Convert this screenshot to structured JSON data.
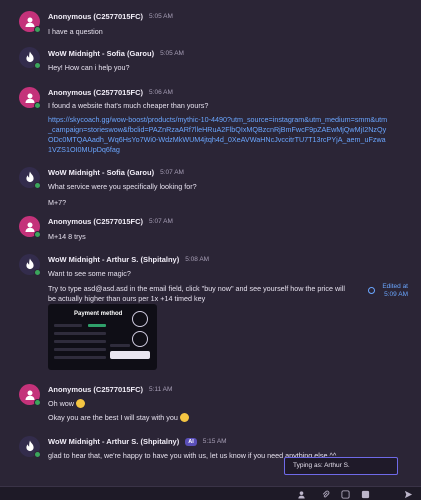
{
  "messages": [
    {
      "author": "Anonymous (C2577015FC)",
      "time": "5:05 AM",
      "avatar": "pink",
      "lines": [
        "I have a question"
      ]
    },
    {
      "author": "WoW Midnight - Sofia (Garou)",
      "time": "5:05 AM",
      "avatar": "purple",
      "lines": [
        "Hey! How can i help you?"
      ]
    },
    {
      "author": "Anonymous (C2577015FC)",
      "time": "5:06 AM",
      "avatar": "pink",
      "lines": [
        "I found a website that's much cheaper than yours?"
      ],
      "link": "https://skycoach.gg/wow-boost/products/mythic-10-4490?utm_source=instagram&utm_medium=smm&utm_campaign=storieswow&fbclid=PAZnRzaARf7lleHRuA2FlbQIxMQBzcnRjBmFwcF9pZAEwMjQwMjI2NzQyODc0MTQAAadh_Wq6HsYo7Wi0-WdzMkWUM4jtqh4d_0XeAVWaHNcJvccitrTU7T13rcPYjA_aem_uFzwa1VZS1OI0MUpDq6fag"
    },
    {
      "author": "WoW Midnight - Sofia (Garou)",
      "time": "5:07 AM",
      "avatar": "purple",
      "lines": [
        "What service were you specifically looking for?",
        "M+7?"
      ]
    },
    {
      "author": "Anonymous (C2577015FC)",
      "time": "5:07 AM",
      "avatar": "pink",
      "lines": [
        "M+14 8 trys"
      ]
    },
    {
      "author": "WoW Midnight - Arthur S. (Shpitalny)",
      "time": "5:08 AM",
      "avatar": "purple",
      "lines": [
        "Want to see some magic?",
        "Try to type asd@asd.asd in the email field, click \"buy now\" and see yourself how the price will be actually higher than ours per 1x +14 timed key"
      ],
      "edited": [
        "Edited at",
        "5:09 AM"
      ],
      "image": {
        "title": "Payment method",
        "label": "payment-method-screenshot"
      }
    },
    {
      "author": "Anonymous (C2577015FC)",
      "time": "5:11 AM",
      "avatar": "pink",
      "lines": [
        "Oh wow",
        "Okay you are the best I will stay with you"
      ]
    },
    {
      "author": "WoW Midnight - Arthur S. (Shpitalny)",
      "time": "5:15 AM",
      "avatar": "purple",
      "badge": "AI",
      "lines": [
        "glad to hear that, we're happy to have you with us, let us know if you need anything else ^^"
      ]
    }
  ],
  "typing_indicator": "Typing as: Arthur S.",
  "colors": {
    "accent": "#6f6ae8",
    "link": "#6aa6ff",
    "online": "#3ba55c",
    "anon_avatar": "#c4327a",
    "agent_avatar": "#332c4c"
  },
  "icons": [
    "fire-logo-icon",
    "user-icon",
    "attachment-icon",
    "emoji-icon",
    "gif-icon",
    "send-icon"
  ]
}
